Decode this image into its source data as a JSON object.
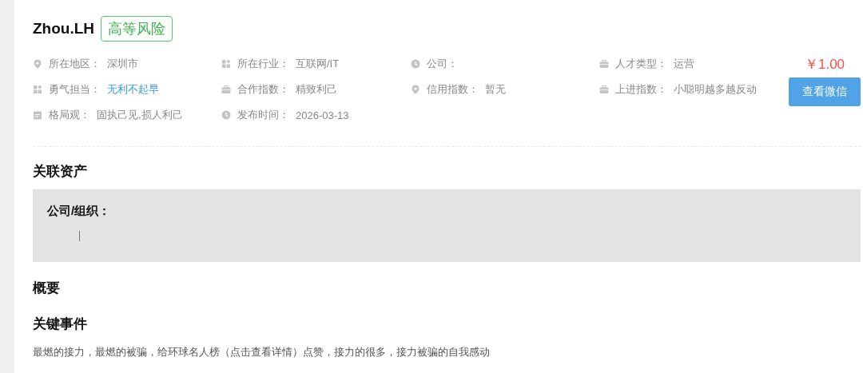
{
  "header": {
    "name": "Zhou.LH",
    "risk_badge": "高等风险"
  },
  "info_rows": [
    [
      {
        "label": "所在地区：",
        "value": "深圳市",
        "kind": "text"
      },
      {
        "label": "所在行业：",
        "value": "互联网/IT",
        "kind": "text"
      },
      {
        "label": "公司："
      },
      {
        "label": "人才类型：",
        "value": "运营",
        "kind": "text"
      }
    ],
    [
      {
        "label": "勇气担当：",
        "value": "无利不起早",
        "kind": "link"
      },
      {
        "label": "合作指数：",
        "value": "精致利己",
        "kind": "text"
      },
      {
        "label": "信用指数：",
        "value": "暂无",
        "kind": "text"
      },
      {
        "label": "上进指数：",
        "value": "小聪明越多越反动",
        "kind": "text"
      }
    ],
    [
      {
        "label": "格局观：",
        "value": "固执己见,损人利己",
        "kind": "text"
      },
      {
        "label": "发布时间：",
        "value": "2026-03-13",
        "kind": "text"
      }
    ]
  ],
  "price": "￥1.00",
  "action_button": "查看微信",
  "related_assets": {
    "title": "关联资产",
    "field_label": "公司/组织："
  },
  "summary": {
    "title": "概要"
  },
  "key_events": {
    "title": "关键事件",
    "text": "最燃的接力，最燃的被骗，给环球名人榜（点击查看详情）点赞，接力的很多，接力被骗的自我感动"
  }
}
